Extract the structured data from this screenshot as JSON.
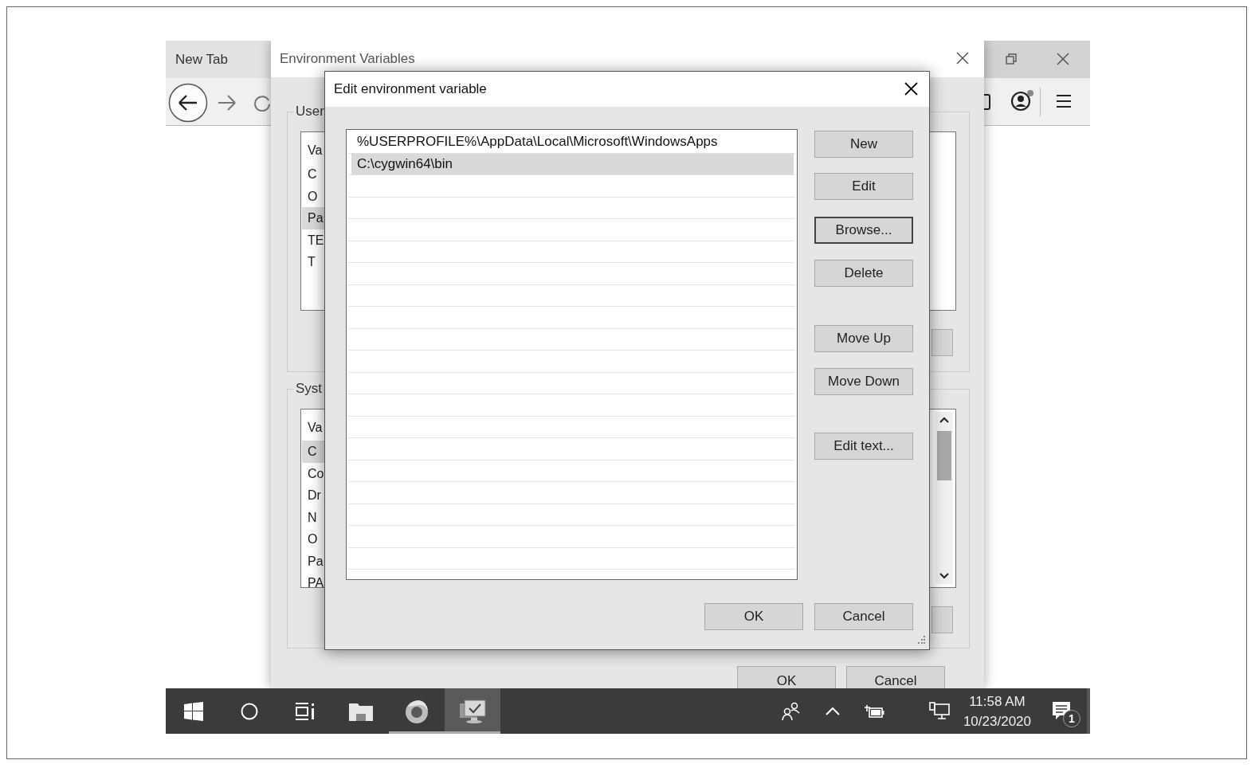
{
  "browser": {
    "tab": {
      "label": "New Tab",
      "selected": true
    }
  },
  "env_window": {
    "title": "Environment Variables",
    "user_group": {
      "label": "User",
      "header": "Va",
      "rows": [
        {
          "text": "C",
          "selected": false
        },
        {
          "text": "O",
          "selected": false
        },
        {
          "text": "Pa",
          "selected": true
        },
        {
          "text": "TE",
          "selected": false
        },
        {
          "text": "T",
          "selected": false
        }
      ]
    },
    "system_group": {
      "label": "Syst",
      "header": "Va",
      "rows": [
        {
          "text": "C",
          "selected": true
        },
        {
          "text": "Co",
          "selected": false
        },
        {
          "text": "Dr",
          "selected": false
        },
        {
          "text": "N",
          "selected": false
        },
        {
          "text": "O",
          "selected": false
        },
        {
          "text": "Pa",
          "selected": false
        },
        {
          "text": "PA",
          "selected": false
        }
      ]
    },
    "buttons": [
      "OK",
      "Cancel"
    ]
  },
  "dialog": {
    "title": "Edit environment variable",
    "entries": [
      {
        "text": "%USERPROFILE%\\AppData\\Local\\Microsoft\\WindowsApps",
        "selected": false
      },
      {
        "text": "C:\\cygwin64\\bin",
        "selected": true
      }
    ],
    "buttons": [
      {
        "label": "New",
        "focused": false
      },
      {
        "label": "Edit",
        "focused": false
      },
      {
        "label": "Browse...",
        "focused": true
      },
      {
        "label": "Delete",
        "focused": false
      },
      {
        "label": "Move Up",
        "focused": false
      },
      {
        "label": "Move Down",
        "focused": false
      },
      {
        "label": "Edit text...",
        "focused": false
      }
    ],
    "footer_buttons": [
      "OK",
      "Cancel"
    ]
  },
  "taskbar": {
    "apps": [
      {
        "kind": "folder",
        "running": false,
        "active": false
      },
      {
        "kind": "browser",
        "running": true,
        "active": false
      },
      {
        "kind": "monitor",
        "running": true,
        "active": true
      }
    ],
    "time": "11:58 AM",
    "date": "10/23/2020",
    "notification_count": "1"
  }
}
